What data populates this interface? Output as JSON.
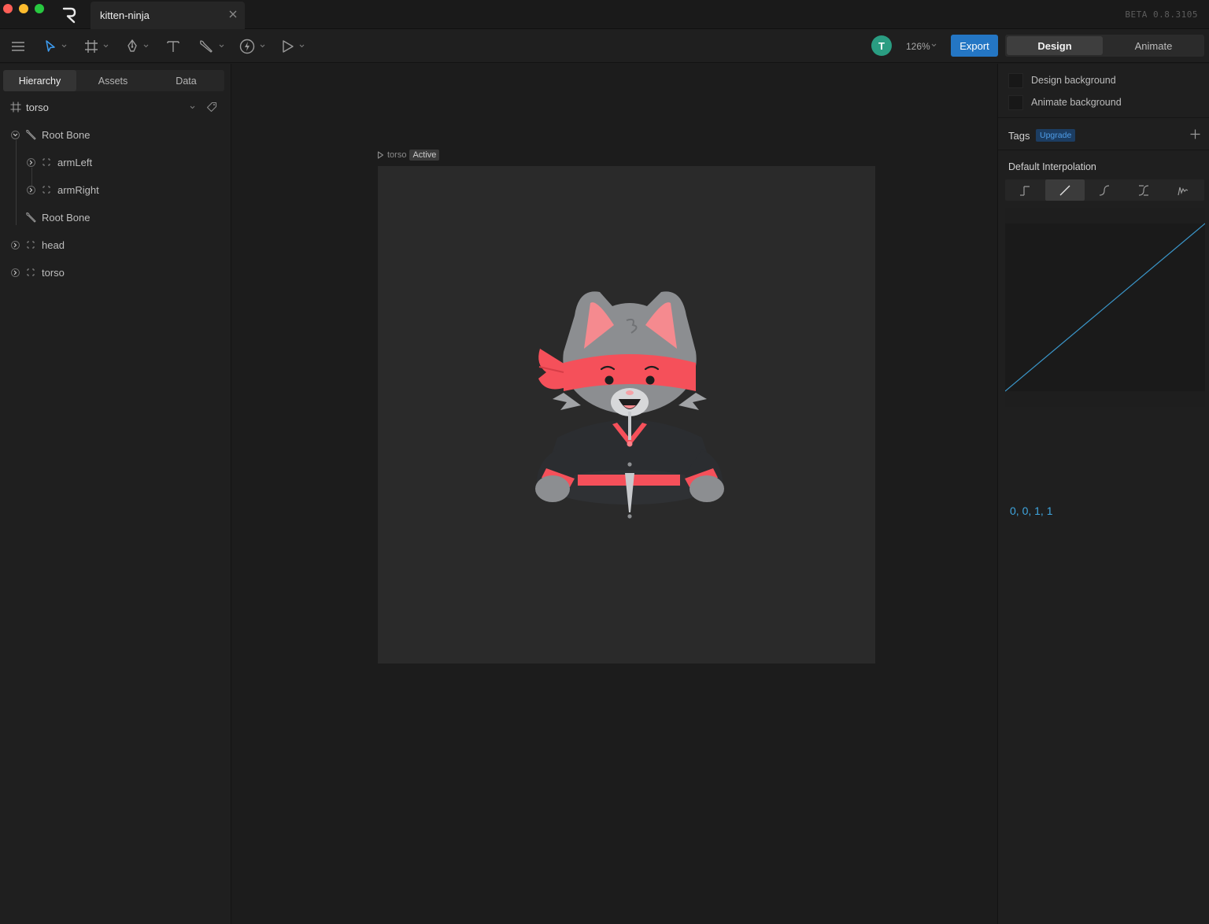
{
  "window": {
    "app": "Rive",
    "tab_title": "kitten-ninja",
    "version": "BETA 0.8.3105"
  },
  "toolbar": {
    "tools": [
      "menu-icon",
      "select-tool-icon",
      "artboard-tool-icon",
      "pen-tool-icon",
      "text-tool-icon",
      "bone-tool-icon",
      "constraint-tool-icon",
      "play-tool-icon"
    ],
    "avatar_initial": "T",
    "zoom": "126%",
    "export_label": "Export",
    "modes": [
      "Design",
      "Animate"
    ],
    "active_mode": "Design"
  },
  "left_panel": {
    "tabs": [
      "Hierarchy",
      "Assets",
      "Data"
    ],
    "active_tab": "Hierarchy",
    "artboard_name": "torso",
    "tree": [
      {
        "label": "Root Bone",
        "icon": "bone-icon",
        "expanded": true
      },
      {
        "label": "armLeft",
        "icon": "group-icon",
        "expanded": false
      },
      {
        "label": "armRight",
        "icon": "group-icon",
        "expanded": false
      },
      {
        "label": "Root Bone",
        "icon": "bone-icon"
      },
      {
        "label": "head",
        "icon": "group-icon",
        "expanded": false
      },
      {
        "label": "torso",
        "icon": "group-icon",
        "expanded": false
      }
    ]
  },
  "canvas": {
    "artboard_label": "torso",
    "artboard_badge": "Active",
    "artboard_color": "#2a2a2a",
    "character": "kitten ninja"
  },
  "right_panel": {
    "backgrounds": [
      "Design background",
      "Animate background"
    ],
    "tags_label": "Tags",
    "upgrade_label": "Upgrade",
    "interpolation_title": "Default Interpolation",
    "interpolation_types": [
      "hold",
      "linear",
      "cubic",
      "cubic-handles",
      "elastic"
    ],
    "active_interpolation": "linear",
    "bezier_values": "0, 0, 1, 1"
  },
  "colors": {
    "accent": "#2476c4",
    "avatar": "#2a9d82",
    "curve": "#3a95c8",
    "ninja_red": "#f5505a"
  }
}
